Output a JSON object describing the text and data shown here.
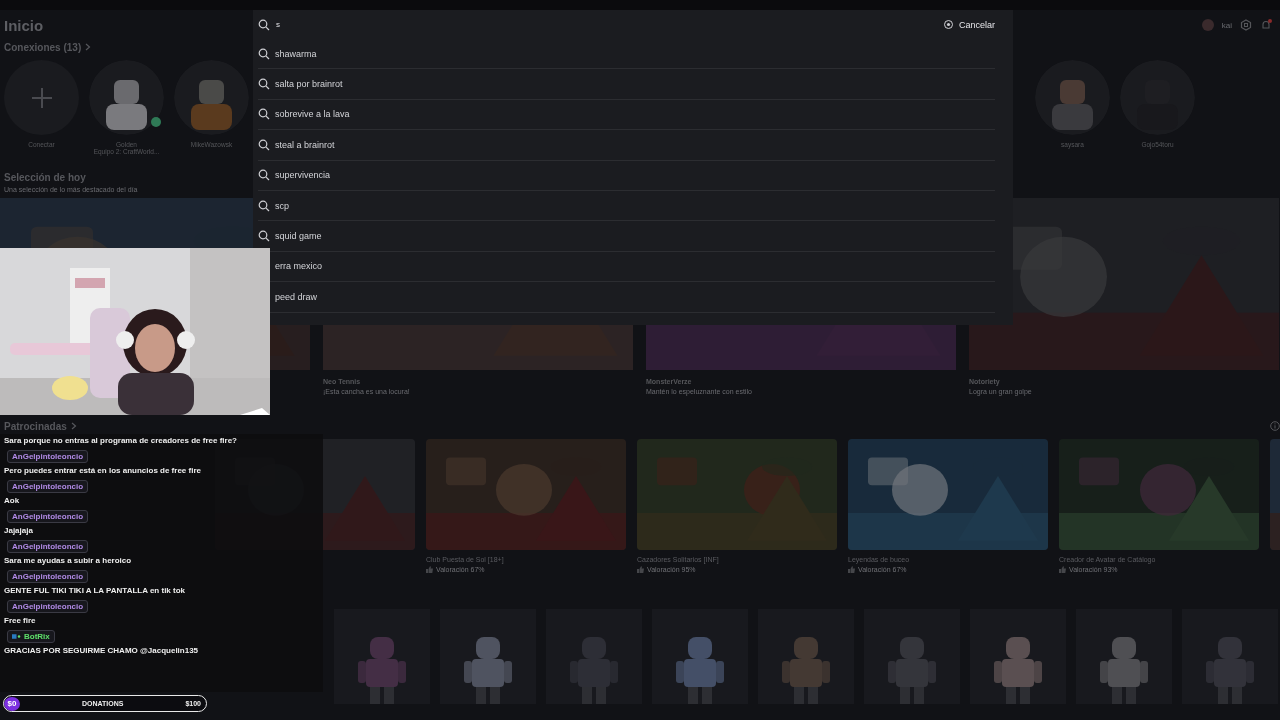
{
  "header": {
    "title": "Inicio",
    "username": "kai"
  },
  "connections": {
    "title": "Conexiones (13)",
    "add_label": "Conectar",
    "friends": [
      {
        "name": "Golden",
        "status": "Equipo 2: CraftWorld...",
        "online": true
      },
      {
        "name": "MikeWazowsk",
        "online": false
      },
      {
        "name": "saysara",
        "online": false
      },
      {
        "name": "Gojo54toru",
        "online": false
      }
    ]
  },
  "today": {
    "title": "Selección de hoy",
    "subtitle": "Una selección de lo más destacado del día",
    "features": [
      {
        "kind": "picture"
      },
      {
        "kind": "game",
        "title": "Neo Tennis",
        "subtitle": "¡Esta cancha es una locura!"
      },
      {
        "kind": "game",
        "title": "MonsterVerze",
        "subtitle": "Mantén lo espeluznante con estilo"
      },
      {
        "kind": "game",
        "title": "Notoriety",
        "subtitle": "Logra un gran golpe"
      }
    ]
  },
  "sponsored": {
    "title": "Patrocinadas",
    "games": [
      {
        "kind": "picture"
      },
      {
        "kind": "game",
        "title": "Club Puesta de Sol [18+]",
        "rating": "Valoración 67%"
      },
      {
        "kind": "game",
        "title": "Cazadores Solitarios [INF]",
        "rating": "Valoración 95%"
      },
      {
        "kind": "game",
        "title": "Leyendas de buceo",
        "rating": "Valoración 67%"
      },
      {
        "kind": "game",
        "title": "Creador de Avatar de Catálogo",
        "rating": "Valoración 93%"
      },
      {
        "kind": "picture"
      }
    ]
  },
  "avatars": [
    {
      "kind": "picture"
    },
    {
      "kind": "picture"
    },
    {
      "kind": "picture"
    },
    {
      "kind": "picture"
    },
    {
      "kind": "picture"
    },
    {
      "kind": "picture"
    },
    {
      "kind": "picture"
    },
    {
      "kind": "picture"
    },
    {
      "kind": "picture"
    }
  ],
  "search": {
    "value": "s",
    "cancel": "Cancelar",
    "suggestions": [
      {
        "kind": "full",
        "text": "shawarma"
      },
      {
        "kind": "full",
        "text": "salta por brainrot"
      },
      {
        "kind": "full",
        "text": "sobrevive a la lava"
      },
      {
        "kind": "full",
        "text": "steal a brainrot"
      },
      {
        "kind": "full",
        "text": "supervivencia"
      },
      {
        "kind": "full",
        "text": "scp"
      },
      {
        "kind": "full",
        "text": "squid game"
      },
      {
        "kind": "cut",
        "text": "erra mexico"
      },
      {
        "kind": "cut",
        "text": "peed draw"
      }
    ]
  },
  "chat": {
    "messages": [
      {
        "kind": "text",
        "text": "Sara porque no entras al programa de creadores de free fire?"
      },
      {
        "kind": "user",
        "user": "AnGelpintoleoncio",
        "text": "Pero puedes entrar está en los anuncios de free fire"
      },
      {
        "kind": "user",
        "user": "AnGelpintoleoncio",
        "text": "Aok"
      },
      {
        "kind": "user",
        "user": "AnGelpintoleoncio",
        "text": "Jajajaja"
      },
      {
        "kind": "user",
        "user": "AnGelpintoleoncio",
        "text": "Sara me ayudas a subir a heroico"
      },
      {
        "kind": "user",
        "user": "AnGelpintoleoncio",
        "text": "GENTE FUL TIKI TIKI A LA PANTALLA en tik tok"
      },
      {
        "kind": "user",
        "user": "AnGelpintoleoncio",
        "text": "Free fire"
      },
      {
        "kind": "bot",
        "user": "BotRix",
        "text": "GRACIAS POR SEGUIRME CHAMO @Jacquelin135"
      }
    ]
  },
  "donations": {
    "start": "$0",
    "label": "DONATIONS",
    "goal": "$100",
    "level": 0
  }
}
